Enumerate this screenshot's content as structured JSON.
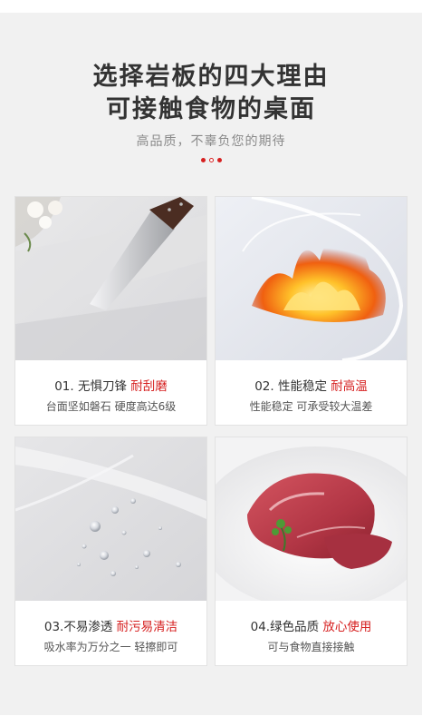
{
  "header": {
    "title_line1": "选择岩板的四大理由",
    "title_line2": "可接触食物的桌面",
    "subtitle": "高品质，不辜负您的期待"
  },
  "colors": {
    "accent": "#d62020",
    "title": "#333333",
    "subtitle": "#8a8a8a",
    "background": "#f1f1f1"
  },
  "features": [
    {
      "number_title": "01. 无惧刀锋 ",
      "highlight": "耐刮磨",
      "description": "台面坚如磐石 硬度高达6级",
      "image": "knife-on-stone-slab"
    },
    {
      "number_title": "02. 性能稳定 ",
      "highlight": "耐高温",
      "description": "性能稳定 可承受较大温差",
      "image": "flame-on-stone-slab"
    },
    {
      "number_title": "03.不易渗透 ",
      "highlight": "耐污易清洁",
      "description": "吸水率为万分之一 轻擦即可",
      "image": "water-droplets-on-slab"
    },
    {
      "number_title": "04.绿色品质 ",
      "highlight": "放心使用",
      "description": "可与食物直接接触",
      "image": "raw-meat-on-plate"
    }
  ]
}
